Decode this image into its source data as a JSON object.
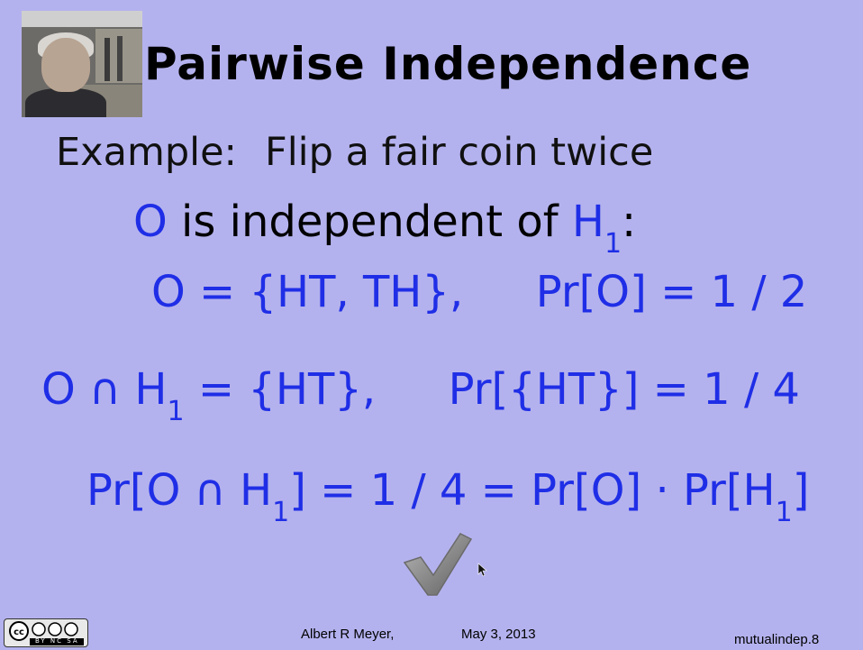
{
  "slide": {
    "title": "Pairwise Independence",
    "example_label": "Example:",
    "example_text": "Flip a fair coin twice",
    "claim": {
      "event": "O",
      "text": "is independent of",
      "event2": "H",
      "event2_sub": "1",
      "colon": ":"
    },
    "definition": {
      "lhs": "O = {HT, TH},",
      "prob": "Pr[O] = 1 / 2"
    },
    "intersection": {
      "lhs_a": "O ∩ H",
      "lhs_sub": "1",
      "lhs_b": " = {HT},",
      "prob": "Pr[{HT}] = 1 / 4"
    },
    "product": {
      "part1": "Pr[O ∩ H",
      "sub1": "1",
      "part2": "] = 1 / 4 = Pr[O] · Pr[H",
      "sub2": "1",
      "part3": "]"
    }
  },
  "footer": {
    "author": "Albert R Meyer,",
    "date": "May 3, 2013",
    "slide_id": "mutualindep.8",
    "license_badge": "BY NC SA"
  },
  "icons": {
    "checkmark": "checkmark-icon",
    "cursor": "mouse-cursor-icon",
    "license": "creative-commons-icon"
  },
  "colors": {
    "background": "#b4b2ee",
    "math_blue": "#1f2ee6",
    "title": "#000000"
  }
}
